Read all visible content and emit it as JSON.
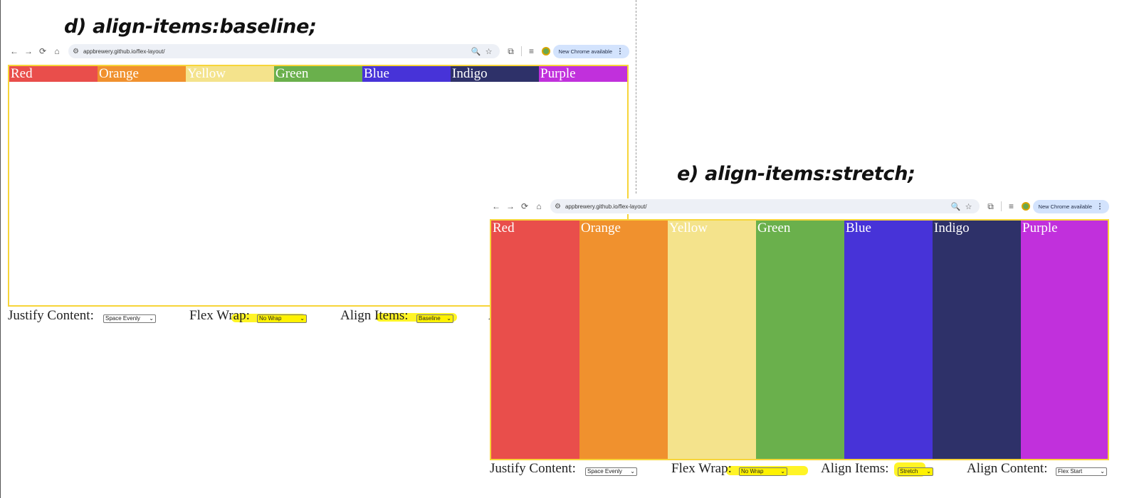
{
  "panel_d": {
    "heading": "d) align-items:baseline;",
    "browser": {
      "url": "appbrewery.github.io/flex-layout/",
      "update_pill": "New Chrome available",
      "menu_glyph": "⋮"
    },
    "boxes": [
      {
        "label": "Red",
        "color": "#e94e4b"
      },
      {
        "label": "Orange",
        "color": "#f0912e"
      },
      {
        "label": "Yellow",
        "color": "#f4e38c"
      },
      {
        "label": "Green",
        "color": "#6ab04c"
      },
      {
        "label": "Blue",
        "color": "#4733d8"
      },
      {
        "label": "Indigo",
        "color": "#2e3169"
      },
      {
        "label": "Purple",
        "color": "#c130dc"
      }
    ],
    "controls": {
      "justify_label": "Justify Content:",
      "justify_value": "Space Evenly",
      "wrap_label": "Flex Wrap:",
      "wrap_value": "No Wrap",
      "align_items_label": "Align Items:",
      "align_items_value": "Baseline",
      "partial_glyph": "A"
    }
  },
  "panel_e": {
    "heading": "e) align-items:stretch;",
    "browser": {
      "url": "appbrewery.github.io/flex-layout/",
      "update_pill": "New Chrome available",
      "menu_glyph": "⋮"
    },
    "boxes": [
      {
        "label": "Red",
        "color": "#e94e4b"
      },
      {
        "label": "Orange",
        "color": "#f0912e"
      },
      {
        "label": "Yellow",
        "color": "#f4e38c"
      },
      {
        "label": "Green",
        "color": "#6ab04c"
      },
      {
        "label": "Blue",
        "color": "#4733d8"
      },
      {
        "label": "Indigo",
        "color": "#2e3169"
      },
      {
        "label": "Purple",
        "color": "#c130dc"
      }
    ],
    "controls": {
      "justify_label": "Justify Content:",
      "justify_value": "Space Evenly",
      "wrap_label": "Flex Wrap:",
      "wrap_value": "No Wrap",
      "align_items_label": "Align Items:",
      "align_items_value": "Stretch",
      "align_content_label": "Align Content:",
      "align_content_value": "Flex Start"
    }
  },
  "icons": {
    "back": "←",
    "forward": "→",
    "reload": "⟳",
    "home": "⌂",
    "tune": "⚙",
    "zoom": "🔍",
    "star": "☆",
    "extensions": "⧉",
    "media": "≡",
    "chevron": "⌄"
  },
  "colors": {
    "frame": "#f7d539",
    "highlight": "#fff200"
  }
}
